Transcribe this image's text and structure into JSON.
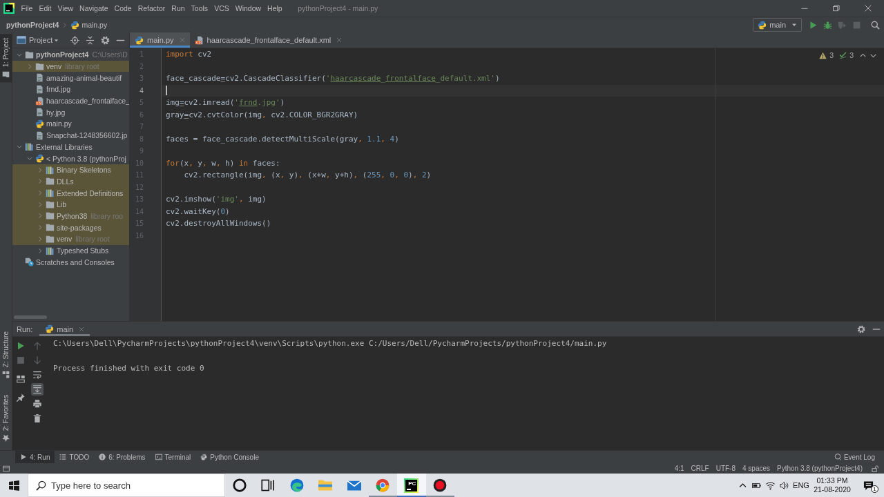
{
  "title_bar": {
    "menu": [
      "File",
      "Edit",
      "View",
      "Navigate",
      "Code",
      "Refactor",
      "Run",
      "Tools",
      "VCS",
      "Window",
      "Help"
    ],
    "title": "pythonProject4 - main.py"
  },
  "nav_bar": {
    "breadcrumbs": [
      {
        "label": "pythonProject4",
        "kind": "project"
      },
      {
        "label": "main.py",
        "kind": "python"
      }
    ],
    "run_config": "main",
    "actions": [
      {
        "kind": "run",
        "disabled": false
      },
      {
        "kind": "debug",
        "disabled": false
      },
      {
        "kind": "coverage",
        "disabled": true
      },
      {
        "kind": "stop",
        "disabled": true
      },
      {
        "kind": "search",
        "disabled": false
      }
    ]
  },
  "tool_stripe": {
    "top": [
      {
        "label": "1: Project",
        "kind": "project",
        "selected": true
      }
    ],
    "bottom": [
      {
        "label": "Z: Structure",
        "kind": "structure",
        "selected": false
      },
      {
        "label": "2: Favorites",
        "kind": "favorites",
        "selected": false
      }
    ]
  },
  "project_panel": {
    "title": "Project",
    "tree": [
      {
        "label": "pythonProject4",
        "hint": "C:\\Users\\D",
        "kind": "project",
        "expanded": true,
        "library": false,
        "children": [
          {
            "label": "venv",
            "hint": "library root",
            "kind": "folder",
            "expanded": false,
            "library": true
          },
          {
            "label": "amazing-animal-beautif",
            "kind": "image",
            "library": false
          },
          {
            "label": "frnd.jpg",
            "kind": "image",
            "library": false
          },
          {
            "label": "haarcascade_frontalface_",
            "kind": "xml",
            "library": false
          },
          {
            "label": "hy.jpg",
            "kind": "image",
            "library": false
          },
          {
            "label": "main.py",
            "kind": "python",
            "library": false
          },
          {
            "label": "Snapchat-1248356602.jp",
            "kind": "image",
            "library": false
          }
        ]
      },
      {
        "label": "External Libraries",
        "kind": "library",
        "expanded": true,
        "library": false,
        "children": [
          {
            "label": "< Python 3.8 (pythonProj",
            "kind": "sdk",
            "expanded": true,
            "library": false,
            "children": [
              {
                "label": "Binary Skeletons",
                "kind": "library",
                "expanded": false,
                "library": true
              },
              {
                "label": "DLLs",
                "kind": "folder",
                "expanded": false,
                "library": true
              },
              {
                "label": "Extended Definitions",
                "kind": "library",
                "expanded": false,
                "library": true
              },
              {
                "label": "Lib",
                "kind": "folder",
                "expanded": false,
                "library": true
              },
              {
                "label": "Python38",
                "hint": "library roo",
                "kind": "folder",
                "expanded": false,
                "library": true
              },
              {
                "label": "site-packages",
                "kind": "folder",
                "expanded": false,
                "library": true
              },
              {
                "label": "venv",
                "hint": "library root",
                "kind": "folder",
                "expanded": false,
                "library": true
              },
              {
                "label": "Typeshed Stubs",
                "kind": "library",
                "expanded": false,
                "library": false
              }
            ]
          }
        ]
      },
      {
        "label": "Scratches and Consoles",
        "kind": "scratches",
        "library": false
      }
    ]
  },
  "editor": {
    "tabs": [
      {
        "label": "main.py",
        "kind": "python",
        "selected": true
      },
      {
        "label": "haarcascade_frontalface_default.xml",
        "kind": "xml",
        "selected": false
      }
    ],
    "inspections": {
      "warnings": "3",
      "typos": "3"
    },
    "lines": [
      {
        "number": "1",
        "current": false,
        "tokens": [
          {
            "kind": "keyword",
            "text": "import"
          },
          {
            "kind": "name",
            "text": " cv2"
          }
        ]
      },
      {
        "number": "2",
        "current": false
      },
      {
        "number": "3",
        "current": false,
        "tokens": [
          {
            "kind": "name",
            "text": "face_cascade"
          },
          {
            "kind": "weak_warning",
            "text": "="
          },
          {
            "kind": "name",
            "text": "cv2.CascadeClassifier("
          },
          {
            "kind": "string",
            "text": "'"
          },
          {
            "kind": "typo",
            "text": "haarcascade"
          },
          {
            "kind": "string",
            "text": "_"
          },
          {
            "kind": "typo",
            "text": "frontalface"
          },
          {
            "kind": "string",
            "text": "_default.xml'"
          },
          {
            "kind": "name",
            "text": ")"
          }
        ]
      },
      {
        "number": "4",
        "current": true
      },
      {
        "number": "5",
        "current": false,
        "tokens": [
          {
            "kind": "name",
            "text": "img"
          },
          {
            "kind": "weak_warning",
            "text": "="
          },
          {
            "kind": "name",
            "text": "cv2.imread("
          },
          {
            "kind": "string",
            "text": "'"
          },
          {
            "kind": "typo",
            "text": "frnd"
          },
          {
            "kind": "string",
            "text": ".jpg'"
          },
          {
            "kind": "name",
            "text": ")"
          }
        ]
      },
      {
        "number": "6",
        "current": false,
        "tokens": [
          {
            "kind": "name",
            "text": "gray"
          },
          {
            "kind": "weak_warning",
            "text": "="
          },
          {
            "kind": "name",
            "text": "cv2.cvtColor(img"
          },
          {
            "kind": "comma",
            "text": ","
          },
          {
            "kind": "name",
            "text": " cv2.COLOR_BGR2GRAY)"
          }
        ]
      },
      {
        "number": "7",
        "current": false
      },
      {
        "number": "8",
        "current": false,
        "tokens": [
          {
            "kind": "name",
            "text": "faces = face_cascade.detectMultiScale(gray"
          },
          {
            "kind": "comma",
            "text": ","
          },
          {
            "kind": "number",
            "text": " 1.1"
          },
          {
            "kind": "comma",
            "text": ","
          },
          {
            "kind": "number",
            "text": " 4"
          },
          {
            "kind": "name",
            "text": ")"
          }
        ]
      },
      {
        "number": "9",
        "current": false
      },
      {
        "number": "10",
        "current": false,
        "tokens": [
          {
            "kind": "keyword",
            "text": "for"
          },
          {
            "kind": "name",
            "text": "(x"
          },
          {
            "kind": "comma",
            "text": ","
          },
          {
            "kind": "name",
            "text": " y"
          },
          {
            "kind": "comma",
            "text": ","
          },
          {
            "kind": "name",
            "text": " w"
          },
          {
            "kind": "comma",
            "text": ","
          },
          {
            "kind": "name",
            "text": " h) "
          },
          {
            "kind": "keyword",
            "text": "in"
          },
          {
            "kind": "name",
            "text": " faces:"
          }
        ]
      },
      {
        "number": "11",
        "current": false,
        "tokens": [
          {
            "kind": "name",
            "text": "    cv2.rectangle(img"
          },
          {
            "kind": "comma",
            "text": ","
          },
          {
            "kind": "name",
            "text": " (x"
          },
          {
            "kind": "comma",
            "text": ","
          },
          {
            "kind": "name",
            "text": " y)"
          },
          {
            "kind": "comma",
            "text": ","
          },
          {
            "kind": "name",
            "text": " (x+w"
          },
          {
            "kind": "comma",
            "text": ","
          },
          {
            "kind": "name",
            "text": " y+h)"
          },
          {
            "kind": "comma",
            "text": ","
          },
          {
            "kind": "name",
            "text": " ("
          },
          {
            "kind": "number",
            "text": "255"
          },
          {
            "kind": "comma",
            "text": ","
          },
          {
            "kind": "number",
            "text": " 0"
          },
          {
            "kind": "comma",
            "text": ","
          },
          {
            "kind": "number",
            "text": " 0"
          },
          {
            "kind": "name",
            "text": ")"
          },
          {
            "kind": "comma",
            "text": ","
          },
          {
            "kind": "number",
            "text": " 2"
          },
          {
            "kind": "name",
            "text": ")"
          }
        ]
      },
      {
        "number": "12",
        "current": false
      },
      {
        "number": "13",
        "current": false,
        "tokens": [
          {
            "kind": "name",
            "text": "cv2.imshow("
          },
          {
            "kind": "string",
            "text": "'img'"
          },
          {
            "kind": "comma",
            "text": ","
          },
          {
            "kind": "name",
            "text": " img)"
          }
        ]
      },
      {
        "number": "14",
        "current": false,
        "tokens": [
          {
            "kind": "name",
            "text": "cv2.waitKey("
          },
          {
            "kind": "number",
            "text": "0"
          },
          {
            "kind": "name",
            "text": ")"
          }
        ]
      },
      {
        "number": "15",
        "current": false,
        "tokens": [
          {
            "kind": "name",
            "text": "cv2.destroyAllWindows()"
          }
        ]
      },
      {
        "number": "16",
        "current": false
      }
    ]
  },
  "run_panel": {
    "label": "Run:",
    "tabs": [
      {
        "label": "main",
        "selected": true
      }
    ],
    "toolbar_left": [
      {
        "kind": "rerun",
        "disabled": false
      },
      {
        "kind": "stop",
        "disabled": true
      },
      {
        "kind": "layout",
        "disabled": false
      },
      {
        "kind": "pin",
        "disabled": false
      }
    ],
    "toolbar_right": [
      {
        "kind": "up",
        "disabled": true,
        "selected": false
      },
      {
        "kind": "down",
        "disabled": true,
        "selected": false
      },
      {
        "kind": "wrap",
        "disabled": false,
        "selected": false
      },
      {
        "kind": "scroll_end",
        "disabled": false,
        "selected": true
      },
      {
        "kind": "print",
        "disabled": false,
        "selected": false
      },
      {
        "kind": "trash",
        "disabled": false,
        "selected": false
      }
    ],
    "output": [
      "C:\\Users\\Dell\\PycharmProjects\\pythonProject4\\venv\\Scripts\\python.exe C:/Users/Dell/PycharmProjects/pythonProject4/main.py",
      "Process finished with exit code 0"
    ]
  },
  "tool_windows_bar": {
    "items": [
      {
        "label": "4: Run",
        "kind": "run",
        "selected": true
      },
      {
        "label": "TODO",
        "kind": "todo",
        "selected": false
      },
      {
        "label": "6: Problems",
        "kind": "problems",
        "selected": false
      },
      {
        "label": "Terminal",
        "kind": "terminal",
        "selected": false
      },
      {
        "label": "Python Console",
        "kind": "console",
        "selected": false
      }
    ],
    "event_log": "Event Log"
  },
  "status_bar": {
    "items": [
      "4:1",
      "CRLF",
      "UTF-8",
      "4 spaces",
      "Python 3.8 (pythonProject4)"
    ]
  },
  "taskbar": {
    "search": {
      "placeholder": "Type here to search"
    },
    "apps": [
      {
        "kind": "cortana",
        "running": false,
        "active": false
      },
      {
        "kind": "task_view",
        "running": false,
        "active": false
      },
      {
        "kind": "edge",
        "running": false,
        "active": false
      },
      {
        "kind": "explorer",
        "running": false,
        "active": false
      },
      {
        "kind": "mail",
        "running": false,
        "active": false
      },
      {
        "kind": "chrome",
        "running": true,
        "active": false
      },
      {
        "kind": "pycharm",
        "running": true,
        "active": true,
        "logo_text": "PC"
      },
      {
        "kind": "recorder",
        "running": true,
        "active": false
      }
    ],
    "language": "ENG",
    "time": "01:33 PM",
    "date": "21-08-2020",
    "notification_count": "1"
  }
}
